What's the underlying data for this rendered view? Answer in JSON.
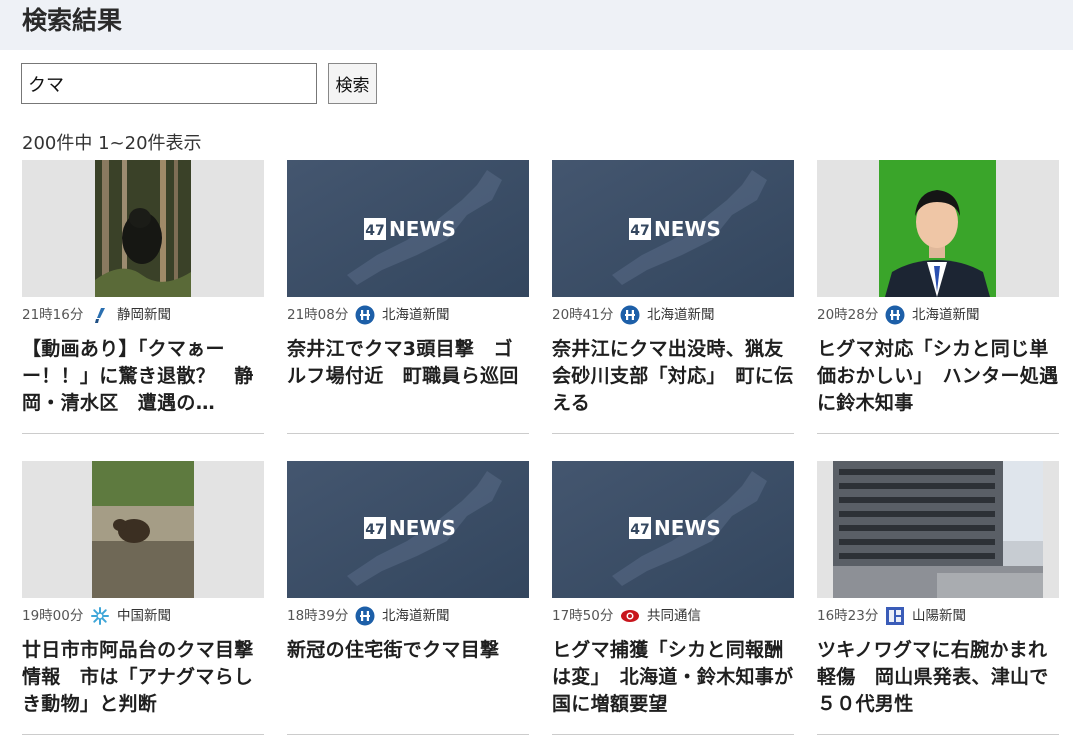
{
  "header": {
    "title": "検索結果"
  },
  "search": {
    "value": "クマ",
    "button_label": "検索"
  },
  "results_info": {
    "count_text": "200件中 1~20件表示"
  },
  "articles": [
    {
      "time": "21時16分",
      "source": "静岡新聞",
      "source_icon": "shizuoka-logo-icon",
      "title": "【動画あり】「クマぁーー！！」に驚き退散？　静岡・清水区　遭遇の…",
      "thumbnail": "bear-in-forest-photo"
    },
    {
      "time": "21時08分",
      "source": "北海道新聞",
      "source_icon": "hokkaido-logo-icon",
      "title": "奈井江でクマ3頭目撃　ゴルフ場付近　町職員ら巡回",
      "thumbnail": "47news-logo",
      "thumb_logo": "47NEWS"
    },
    {
      "time": "20時41分",
      "source": "北海道新聞",
      "source_icon": "hokkaido-logo-icon",
      "title": "奈井江にクマ出没時、猟友会砂川支部「対応」　町に伝える",
      "thumbnail": "47news-logo",
      "thumb_logo": "47NEWS"
    },
    {
      "time": "20時28分",
      "source": "北海道新聞",
      "source_icon": "hokkaido-logo-icon",
      "title": "ヒグマ対応「シカと同じ単価おかしい」　ハンター処遇に鈴木知事",
      "thumbnail": "governor-portrait-photo"
    },
    {
      "time": "19時00分",
      "source": "中国新聞",
      "source_icon": "chugoku-logo-icon",
      "title": "廿日市市阿品台のクマ目撃情報　市は「アナグマらしき動物」と判断",
      "thumbnail": "animal-near-wall-photo"
    },
    {
      "time": "18時39分",
      "source": "北海道新聞",
      "source_icon": "hokkaido-logo-icon",
      "title": "新冠の住宅街でクマ目撃",
      "thumbnail": "47news-logo",
      "thumb_logo": "47NEWS"
    },
    {
      "time": "17時50分",
      "source": "共同通信",
      "source_icon": "kyodo-logo-icon",
      "title": "ヒグマ捕獲「シカと同報酬は変」　北海道・鈴木知事が国に増額要望",
      "thumbnail": "47news-logo",
      "thumb_logo": "47NEWS"
    },
    {
      "time": "16時23分",
      "source": "山陽新聞",
      "source_icon": "sanyo-logo-icon",
      "title": "ツキノワグマに右腕かまれ軽傷　岡山県発表、津山で５０代男性",
      "thumbnail": "government-building-photo"
    }
  ]
}
